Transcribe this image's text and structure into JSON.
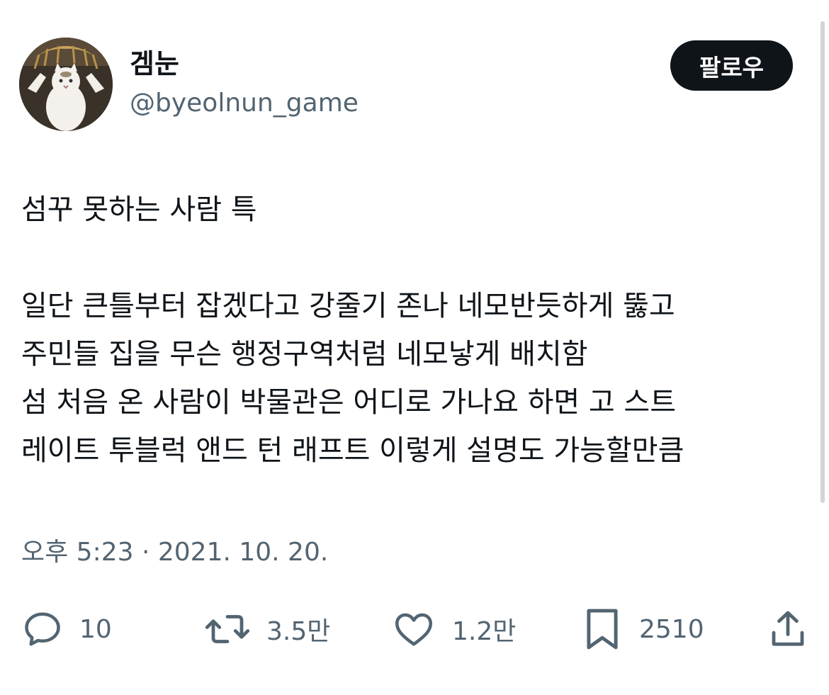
{
  "author": {
    "display_name": "겜눈",
    "handle": "@byeolnun_game"
  },
  "follow_button": {
    "label": "팔로우"
  },
  "tweet": {
    "lines": [
      "섬꾸 못하는 사람 특",
      "",
      "일단 큰틀부터 잡겠다고 강줄기 존나 네모반듯하게 뚫고",
      "주민들 집을 무슨 행정구역처럼 네모낳게 배치함",
      "섬 처음 온 사람이 박물관은 어디로 가나요 하면 고 스트",
      "레이트 투블럭 앤드 턴 래프트 이렇게 설명도 가능할만큼"
    ],
    "timestamp": "오후 5:23 · 2021. 10. 20."
  },
  "actions": {
    "reply": {
      "icon": "reply-icon",
      "count": "10"
    },
    "retweet": {
      "icon": "retweet-icon",
      "count": "3.5만"
    },
    "like": {
      "icon": "heart-icon",
      "count": "1.2만"
    },
    "bookmark": {
      "icon": "bookmark-icon",
      "count": "2510"
    },
    "share": {
      "icon": "share-icon"
    }
  },
  "colors": {
    "text_primary": "#0f1419",
    "text_secondary": "#536471",
    "button_background": "#0f1419",
    "button_text": "#ffffff"
  }
}
